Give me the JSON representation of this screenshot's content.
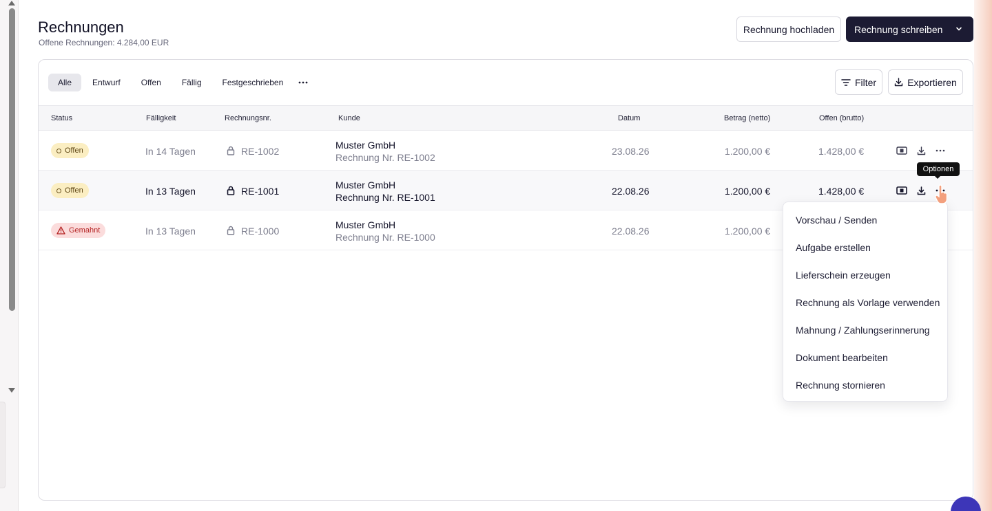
{
  "header": {
    "title": "Rechnungen",
    "subtitle": "Offene Rechnungen: 4.284,00 EUR",
    "upload_label": "Rechnung hochladen",
    "write_label": "Rechnung schreiben"
  },
  "tabs": [
    "Alle",
    "Entwurf",
    "Offen",
    "Fällig",
    "Festgeschrieben"
  ],
  "toolbar": {
    "filter_label": "Filter",
    "export_label": "Exportieren"
  },
  "table": {
    "columns": [
      "Status",
      "Fälligkeit",
      "Rechnungsnr.",
      "Kunde",
      "Datum",
      "Betrag (netto)",
      "Offen (brutto)"
    ],
    "rows": [
      {
        "status": "Offen",
        "due": "In 14 Tagen",
        "number": "RE-1002",
        "customer": "Muster GmbH",
        "customer_sub": "Rechnung Nr. RE-1002",
        "date": "23.08.26",
        "net": "1.200,00 €",
        "open": "1.428,00 €"
      },
      {
        "status": "Offen",
        "due": "In 13 Tagen",
        "number": "RE-1001",
        "customer": "Muster GmbH",
        "customer_sub": "Rechnung Nr. RE-1001",
        "date": "22.08.26",
        "net": "1.200,00 €",
        "open": "1.428,00 €"
      },
      {
        "status": "Gemahnt",
        "due": "In 13 Tagen",
        "number": "RE-1000",
        "customer": "Muster GmbH",
        "customer_sub": "Rechnung Nr. RE-1000",
        "date": "22.08.26",
        "net": "1.200,00 €",
        "open": ""
      }
    ]
  },
  "tooltip": "Optionen",
  "menu": [
    "Vorschau / Senden",
    "Aufgabe erstellen",
    "Lieferschein erzeugen",
    "Rechnung als Vorlage verwenden",
    "Mahnung / Zahlungserinnerung",
    "Dokument bearbeiten",
    "Rechnung stornieren"
  ],
  "colors": {
    "primary": "#1c1b33",
    "badge_open": "#fbeec2",
    "badge_dunned": "#fbdcdc",
    "chat": "#3d36b8"
  }
}
